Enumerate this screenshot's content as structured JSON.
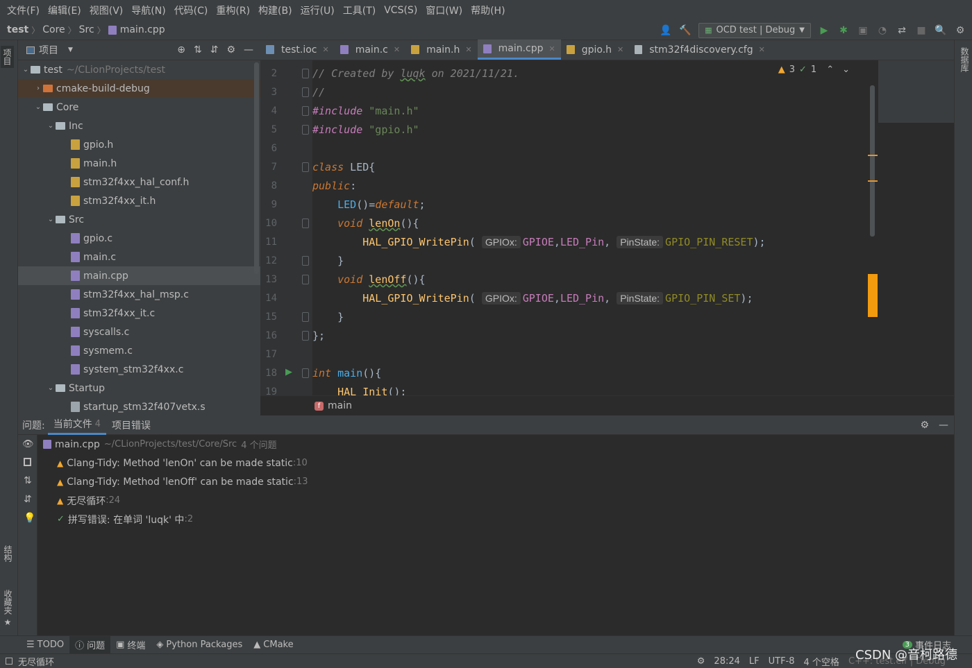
{
  "menu": [
    "文件(F)",
    "编辑(E)",
    "视图(V)",
    "导航(N)",
    "代码(C)",
    "重构(R)",
    "构建(B)",
    "运行(U)",
    "工具(T)",
    "VCS(S)",
    "窗口(W)",
    "帮助(H)"
  ],
  "breadcrumb": {
    "project": "test",
    "c1": "Core",
    "c2": "Src",
    "file": "main.cpp"
  },
  "run_config": "OCD test | Debug",
  "left_strip": {
    "project": "项目",
    "structure": "结构",
    "bookmarks": "收藏夹"
  },
  "right_strip": {
    "database": "数据库"
  },
  "project_panel": {
    "title": "项目"
  },
  "tree": [
    {
      "label": "test",
      "extra": "~/CLionProjects/test"
    },
    {
      "label": "cmake-build-debug"
    },
    {
      "label": "Core"
    },
    {
      "label": "Inc"
    },
    {
      "label": "gpio.h"
    },
    {
      "label": "main.h"
    },
    {
      "label": "stm32f4xx_hal_conf.h"
    },
    {
      "label": "stm32f4xx_it.h"
    },
    {
      "label": "Src"
    },
    {
      "label": "gpio.c"
    },
    {
      "label": "main.c"
    },
    {
      "label": "main.cpp"
    },
    {
      "label": "stm32f4xx_hal_msp.c"
    },
    {
      "label": "stm32f4xx_it.c"
    },
    {
      "label": "syscalls.c"
    },
    {
      "label": "sysmem.c"
    },
    {
      "label": "system_stm32f4xx.c"
    },
    {
      "label": "Startup"
    },
    {
      "label": "startup_stm32f407vetx.s"
    }
  ],
  "tabs": [
    "test.ioc",
    "main.c",
    "main.h",
    "main.cpp",
    "gpio.h",
    "stm32f4discovery.cfg"
  ],
  "editor": {
    "line_numbers": [
      "2",
      "3",
      "4",
      "5",
      "6",
      "7",
      "8",
      "9",
      "10",
      "11",
      "12",
      "13",
      "14",
      "15",
      "16",
      "17",
      "18",
      "19"
    ],
    "inspection": {
      "warnings": "3",
      "typos": "1"
    },
    "hints": {
      "gpiox": "GPIOx:",
      "pinstate": "PinState:"
    }
  },
  "editor_breadcrumb": "main",
  "problems": {
    "label": "问题:",
    "tab_current": "当前文件",
    "tab_current_count": "4",
    "tab_project": "项目错误",
    "file": "main.cpp",
    "file_path": "~/CLionProjects/test/Core/Src",
    "file_count": "4 个问题",
    "items": [
      {
        "text": "Clang-Tidy: Method 'lenOn' can be made static",
        "line": ":10"
      },
      {
        "text": "Clang-Tidy: Method 'lenOff' can be made static",
        "line": ":13"
      },
      {
        "text": "无尽循环",
        "line": ":24"
      },
      {
        "text": "拼写错误: 在单词 'luqk' 中",
        "line": ":2"
      }
    ]
  },
  "bottom_tabs": [
    "TODO",
    "问题",
    "终端",
    "Python Packages",
    "CMake"
  ],
  "event_log": "事件日志",
  "event_count": "3",
  "status": {
    "message": "无尽循环",
    "position": "28:24",
    "line_sep": "LF",
    "encoding": "UTF-8",
    "indent": "4 个空格",
    "context": "C++: test.elf | Debug"
  },
  "watermark": "CSDN @音柯路德"
}
